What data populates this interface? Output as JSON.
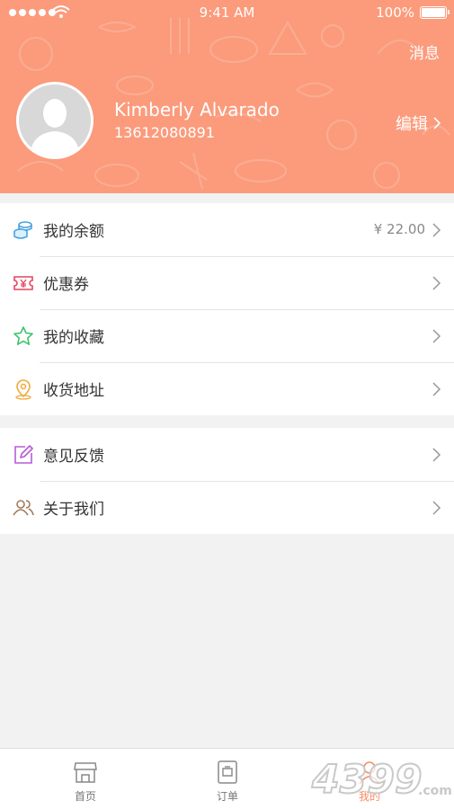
{
  "status_bar": {
    "time": "9:41 AM",
    "battery": "100%"
  },
  "header": {
    "messages_label": "消息",
    "user_name": "Kimberly Alvarado",
    "user_phone": "13612080891",
    "edit_label": "编辑",
    "bg_color": "#fb9b7c"
  },
  "menu_group_1": [
    {
      "label": "我的余额",
      "value": "¥ 22.00",
      "icon": "coins-icon"
    },
    {
      "label": "优惠券",
      "icon": "coupon-icon"
    },
    {
      "label": "我的收藏",
      "icon": "star-icon"
    },
    {
      "label": "收货地址",
      "icon": "location-icon"
    }
  ],
  "menu_group_2": [
    {
      "label": "意见反馈",
      "icon": "edit-feedback-icon"
    },
    {
      "label": "关于我们",
      "icon": "people-icon"
    }
  ],
  "tabbar": [
    {
      "label": "首页",
      "icon": "store-icon"
    },
    {
      "label": "订单",
      "icon": "order-icon"
    },
    {
      "label": "我的",
      "icon": "user-icon",
      "active": true
    }
  ],
  "watermark": {
    "text": "4399",
    "suffix": ".com"
  },
  "colors": {
    "accent": "#fb8a63",
    "header": "#fb9b7c"
  }
}
